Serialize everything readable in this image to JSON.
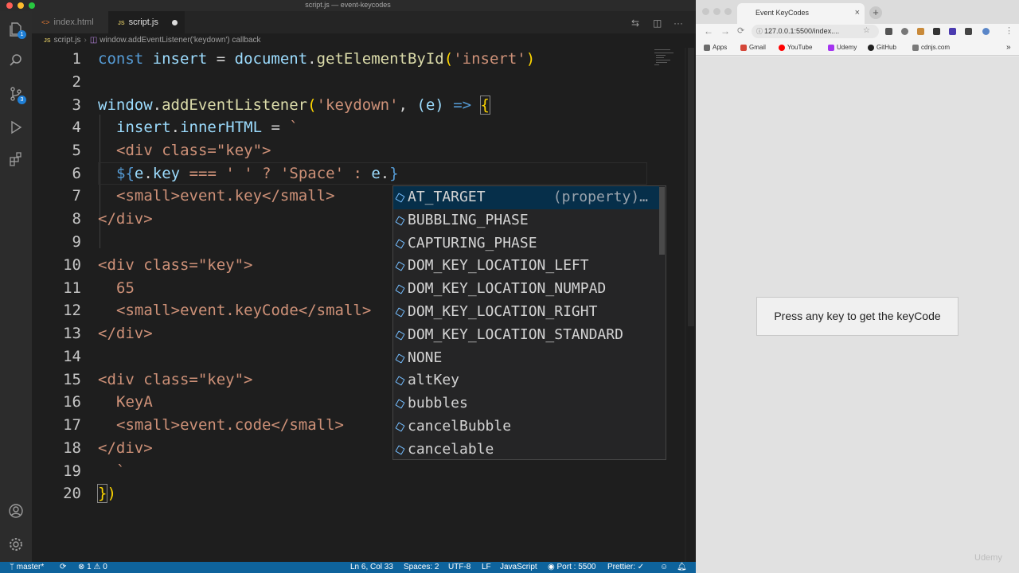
{
  "vscode": {
    "window_title": "script.js — event-keycodes",
    "tabs": [
      {
        "icon": "JS",
        "label": "index.html"
      },
      {
        "icon": "JS",
        "label": "script.js"
      }
    ],
    "breadcrumb": {
      "file_icon": "JS",
      "file": "script.js",
      "symbol": "window.addEventListener('keydown') callback"
    },
    "activity_badges": {
      "explorer": "1",
      "scm": "3"
    },
    "line_numbers": [
      "1",
      "2",
      "3",
      "4",
      "5",
      "6",
      "7",
      "8",
      "9",
      "10",
      "11",
      "12",
      "13",
      "14",
      "15",
      "16",
      "17",
      "18",
      "19",
      "20"
    ],
    "code": {
      "l1": {
        "kw": "const",
        "var": "insert",
        "eq": " = ",
        "obj": "document",
        "dot": ".",
        "fn": "getElementById",
        "open": "(",
        "str": "'insert'",
        "close": ")"
      },
      "l3": {
        "obj": "window",
        "dot": ".",
        "fn": "addEventListener",
        "open": "(",
        "str": "'keydown'",
        "comma": ", ",
        "param": "(e)",
        "arrow": " => ",
        "brace": "{"
      },
      "l4": {
        "var": "insert",
        "dot": ".",
        "prop": "innerHTML",
        "eq": " = ",
        "tick": "`"
      },
      "l5": "<div class=\"key\">",
      "l6": {
        "open": "${",
        "e1": "e",
        "d1": ".",
        "key": "key",
        "rest": " === ' ' ? 'Space' : ",
        "e2": "e",
        "d2": ".",
        "close": "}"
      },
      "l7": "<small>event.key</small>",
      "l8": "</div>",
      "l10": "<div class=\"key\">",
      "l11": "65",
      "l12": "<small>event.keyCode</small>",
      "l13": "</div>",
      "l15": "<div class=\"key\">",
      "l16": "KeyA",
      "l17": "<small>event.code</small>",
      "l18": "</div>",
      "l19": "`",
      "l20a": "}",
      "l20b": ")"
    },
    "suggest": {
      "items": [
        "AT_TARGET",
        "BUBBLING_PHASE",
        "CAPTURING_PHASE",
        "DOM_KEY_LOCATION_LEFT",
        "DOM_KEY_LOCATION_NUMPAD",
        "DOM_KEY_LOCATION_RIGHT",
        "DOM_KEY_LOCATION_STANDARD",
        "NONE",
        "altKey",
        "bubbles",
        "cancelBubble",
        "cancelable"
      ],
      "selected_detail": "(property)…"
    },
    "statusbar": {
      "branch": "master*",
      "problems": "⊗ 1 ⚠ 0",
      "position": "Ln 6, Col 33",
      "spaces": "Spaces: 2",
      "encoding": "UTF-8",
      "eol": "LF",
      "language": "JavaScript",
      "port": "Port : 5500",
      "prettier": "Prettier: ✓"
    },
    "colors": {
      "statusbar": "#0e639c",
      "keyword": "#569cd6",
      "string": "#ce9178",
      "function": "#dcdcaa",
      "variable": "#9cdcfe"
    }
  },
  "chrome": {
    "tab_title": "Event KeyCodes",
    "tab_close": "×",
    "new_tab": "+",
    "nav": {
      "back": "←",
      "forward": "→",
      "reload": "C"
    },
    "url": "127.0.0.1:5500/index....",
    "bookmarks": [
      "Apps",
      "Gmail",
      "YouTube",
      "Udemy",
      "GitHub",
      "cdnjs.com"
    ],
    "page": {
      "message": "Press any key to get the keyCode"
    },
    "watermark": "Udemy"
  }
}
